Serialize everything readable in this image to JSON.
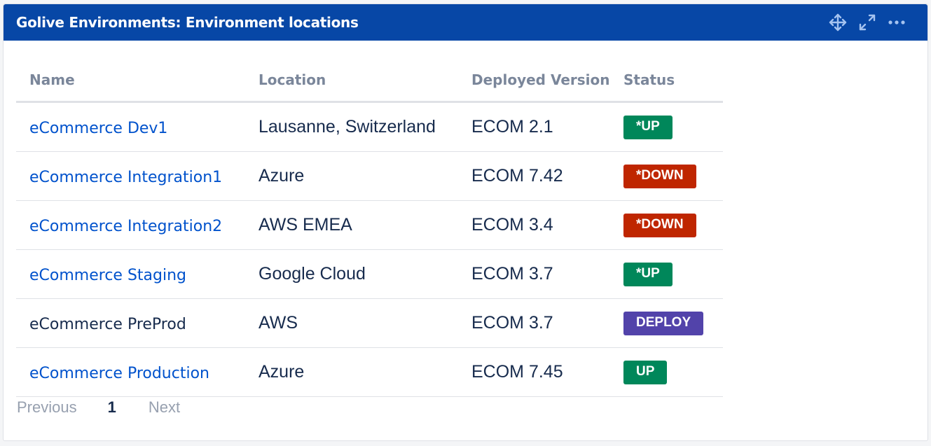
{
  "gadget": {
    "title": "Golive Environments: Environment locations",
    "icons": [
      "move-icon",
      "expand-icon",
      "more-icon"
    ]
  },
  "table": {
    "headers": [
      "Name",
      "Location",
      "Deployed Version",
      "Status"
    ],
    "rows": [
      {
        "name": "eCommerce Dev1",
        "link": true,
        "location": "Lausanne, Switzerland",
        "version": "ECOM 2.1",
        "status": "*UP",
        "status_color": "#00875a"
      },
      {
        "name": "eCommerce Integration1",
        "link": true,
        "location": "Azure",
        "version": "ECOM 7.42",
        "status": "*DOWN",
        "status_color": "#bf2600"
      },
      {
        "name": "eCommerce Integration2",
        "link": true,
        "location": "AWS EMEA",
        "version": "ECOM 3.4",
        "status": "*DOWN",
        "status_color": "#bf2600"
      },
      {
        "name": "eCommerce Staging",
        "link": true,
        "location": "Google Cloud",
        "version": "ECOM 3.7",
        "status": "*UP",
        "status_color": "#00875a"
      },
      {
        "name": "eCommerce PreProd",
        "link": false,
        "location": "AWS",
        "version": "ECOM 3.7",
        "status": "DEPLOY",
        "status_color": "#5243aa"
      },
      {
        "name": "eCommerce Production",
        "link": true,
        "location": "Azure",
        "version": "ECOM 7.45",
        "status": "UP",
        "status_color": "#00875a"
      }
    ]
  },
  "pagination": {
    "previous": "Previous",
    "current": "1",
    "next": "Next"
  },
  "colors": {
    "header_bg": "#0747a6",
    "link": "#0052cc",
    "up": "#00875a",
    "down": "#bf2600",
    "deploy": "#5243aa"
  }
}
